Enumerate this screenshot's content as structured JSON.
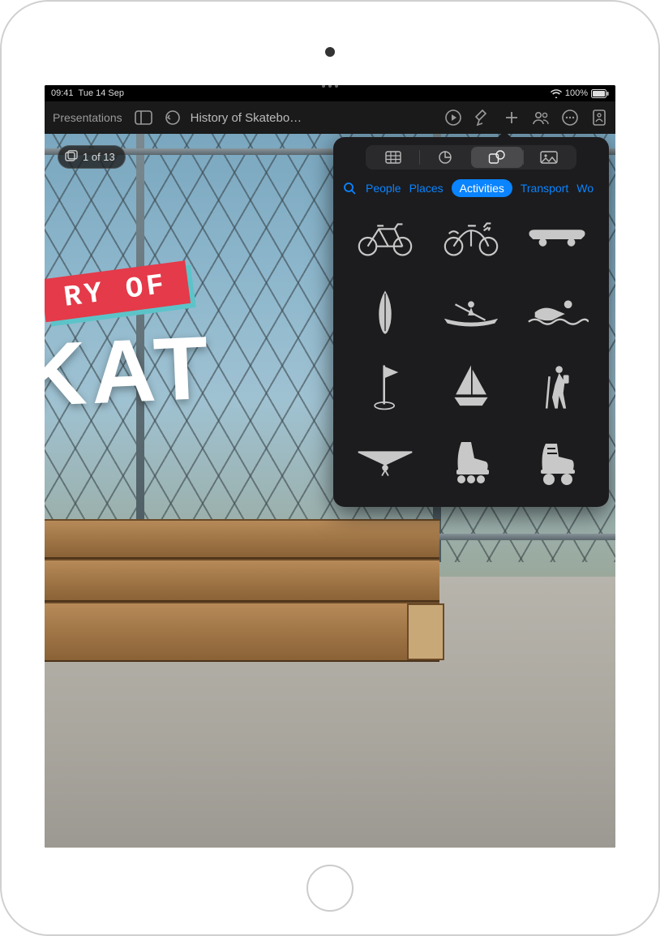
{
  "status": {
    "time": "09:41",
    "date": "Tue 14 Sep",
    "battery": "100%"
  },
  "toolbar": {
    "back_label": "Presentations",
    "title": "History of Skatebo…"
  },
  "slide_nav": {
    "counter": "1 of 13"
  },
  "slide": {
    "title_line1": "RY OF",
    "title_line2": "KAT"
  },
  "insert_popover": {
    "segments": [
      "tables",
      "charts",
      "shapes",
      "media"
    ],
    "selected_segment": "shapes",
    "categories": [
      "People",
      "Places",
      "Activities",
      "Transport",
      "Wo"
    ],
    "selected_category": "Activities",
    "shapes": [
      "bicycle-road",
      "bicycle-city",
      "skateboard",
      "surfboard",
      "rowing",
      "swimming",
      "golf-flag",
      "sailboat",
      "hiking",
      "hang-glider",
      "rollerblade",
      "rollerskate"
    ]
  }
}
